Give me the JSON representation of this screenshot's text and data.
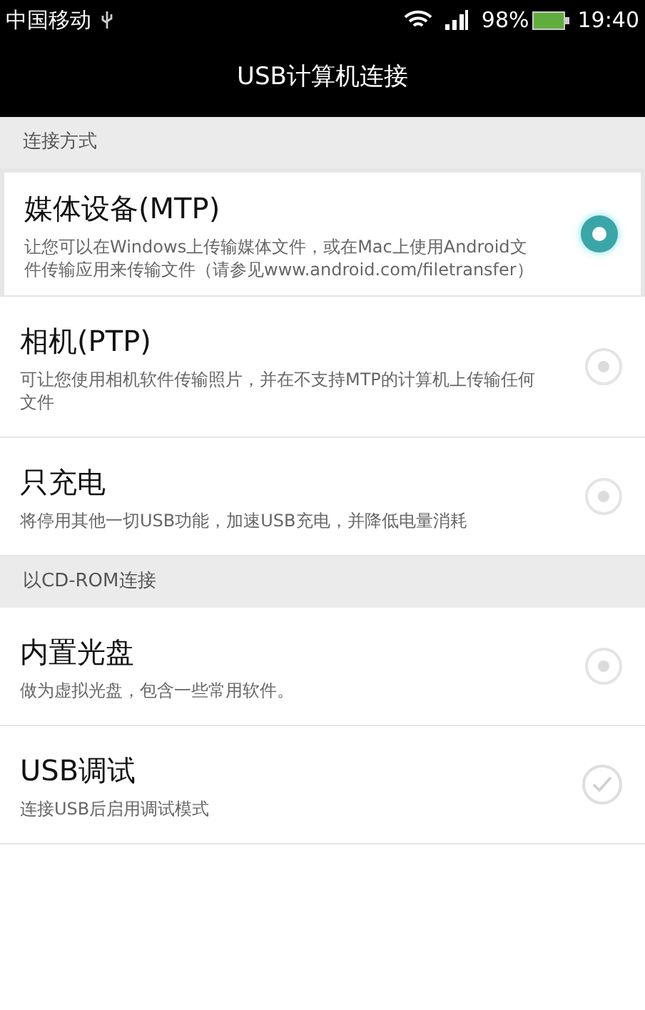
{
  "status_bar": {
    "carrier": "中国移动",
    "battery": "98%",
    "time": "19:40"
  },
  "title": "USB计算机连接",
  "sections": [
    {
      "header": "连接方式",
      "items": [
        {
          "kind": "radio",
          "title": "媒体设备(MTP)",
          "description": "让您可以在Windows上传输媒体文件，或在Mac上使用Android文件传输应用来传输文件（请参见www.android.com/filetransfer）",
          "selected": true,
          "highlighted": true
        },
        {
          "kind": "radio",
          "title": "相机(PTP)",
          "description": "可让您使用相机软件传输照片，并在不支持MTP的计算机上传输任何文件",
          "selected": false,
          "highlighted": false
        },
        {
          "kind": "radio",
          "title": "只充电",
          "description": "将停用其他一切USB功能，加速USB充电，并降低电量消耗",
          "selected": false,
          "highlighted": false
        }
      ]
    },
    {
      "header": "以CD-ROM连接",
      "items": [
        {
          "kind": "radio",
          "title": "内置光盘",
          "description": "做为虚拟光盘，包含一些常用软件。",
          "selected": false,
          "highlighted": false
        },
        {
          "kind": "checkbox",
          "title": "USB调试",
          "description": "连接USB后启用调试模式",
          "checked": false,
          "highlighted": false
        }
      ]
    }
  ]
}
